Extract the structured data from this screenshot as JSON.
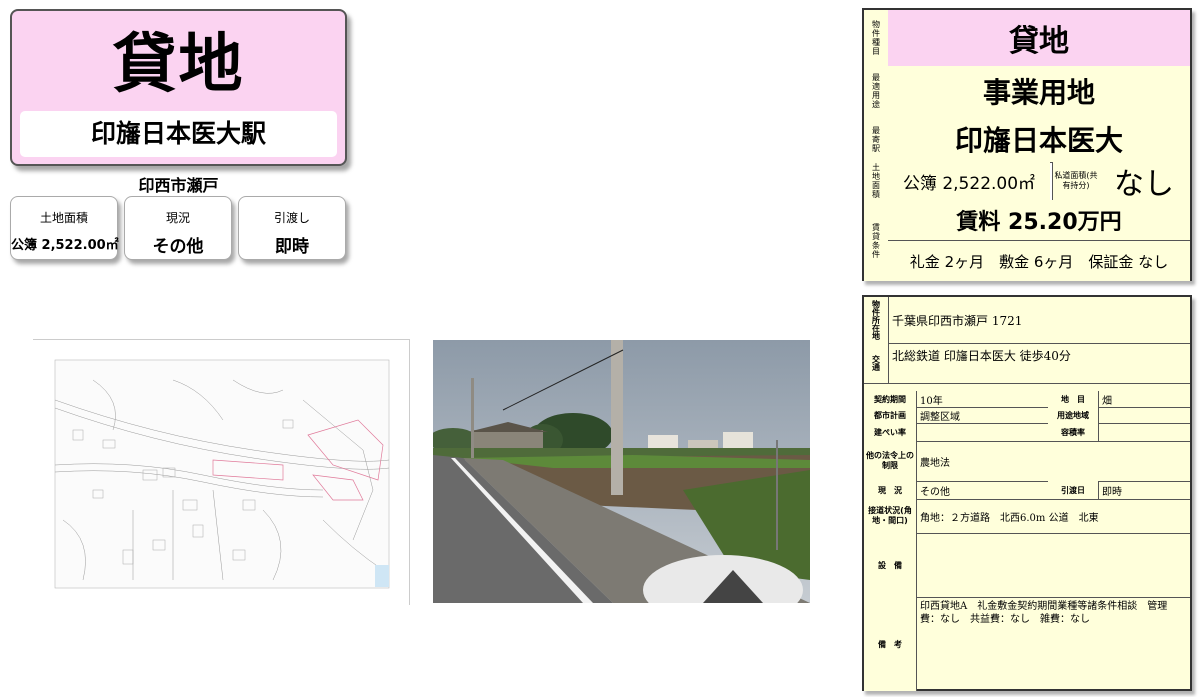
{
  "header": {
    "title": "貸地",
    "station": "印旛日本医大駅"
  },
  "city": "印西市瀬戸",
  "cards": [
    {
      "label": "土地面積",
      "value": "公簿 2,522.00㎡"
    },
    {
      "label": "現況",
      "value": "その他"
    },
    {
      "label": "引渡し",
      "value": "即時"
    }
  ],
  "summary": {
    "type_label": "物件種目",
    "type_value": "貸地",
    "use_label": "最適用途",
    "use_value": "事業用地",
    "station_label": "最寄駅",
    "station_value": "印旛日本医大",
    "area_label": "土地面積",
    "area_value": "公簿 2,522.00㎡",
    "private_road_label": "私道面積(共有持分)",
    "private_road_value": "なし",
    "rent_label": "賃貸条件",
    "rent_value": "賃料 25.20万円",
    "terms_value": "礼金 2ヶ月　敷金 6ヶ月　保証金 なし"
  },
  "details": {
    "location_label": "物件所在地",
    "location_value": "千葉県印西市瀬戸 1721",
    "transport_label": "交通",
    "transport_value": "北総鉄道 印旛日本医大 徒歩40分",
    "term_label": "契約期間",
    "term_value": "10年",
    "chimoku_label": "地　目",
    "chimoku_value": "畑",
    "plan_label": "都市計画",
    "plan_value": "調整区域",
    "zone_label": "用途地域",
    "zone_value": "",
    "bcr_label": "建ぺい率",
    "bcr_value": "",
    "far_label": "容積率",
    "far_value": "",
    "law_label": "他の法令上の制限",
    "law_value": "農地法",
    "status_label": "現　況",
    "status_value": "その他",
    "handover_label": "引渡日",
    "handover_value": "即時",
    "road_label": "接道状況(角地・間口)",
    "road_value": "角地：２方道路　北西6.0m 公道　北東",
    "equip_label": "設　備",
    "equip_value": "",
    "remarks_label": "備　考",
    "remarks_value": "印西貸地A　礼金敷金契約期間業種等諸条件相談　管理費：なし　共益費：なし　雑費：なし"
  }
}
